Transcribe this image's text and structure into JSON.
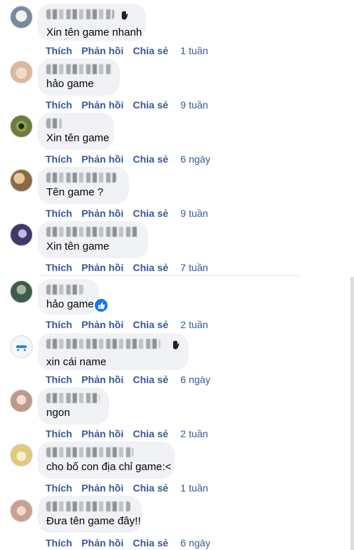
{
  "actions": {
    "like": "Thích",
    "reply": "Phản hồi",
    "share": "Chia sẻ"
  },
  "comments": [
    {
      "text": "Xin tên game nhanh",
      "time": "1 tuần",
      "avatar_color": "#7b8a9a"
    },
    {
      "text": "hảo game",
      "time": "9 tuần",
      "avatar_color": "#d9b89c"
    },
    {
      "text": "Xin tên game",
      "time": "6 ngày",
      "avatar_color": "#6f7a3f"
    },
    {
      "text": "Tên game ?",
      "time": "9 tuần",
      "avatar_color": "#8a6a45"
    },
    {
      "text": "Xin tên game",
      "time": "7 tuần",
      "avatar_color": "#3d3a6b"
    },
    {
      "text": "hảo game",
      "time": "2 tuần",
      "avatar_color": "#3f5c4a"
    },
    {
      "text": "xin cái name",
      "time": "6 ngày",
      "avatar_color": "#e8eef5"
    },
    {
      "text": "ngon",
      "time": "2 tuần",
      "avatar_color": "#b99a8c"
    },
    {
      "text": "cho bố con địa chỉ game:<",
      "time": "1 tuần",
      "avatar_color": "#e2c97a"
    },
    {
      "text": "Đưa tên game đây!!",
      "time": "6 ngày",
      "avatar_color": "#c9a08f"
    }
  ]
}
